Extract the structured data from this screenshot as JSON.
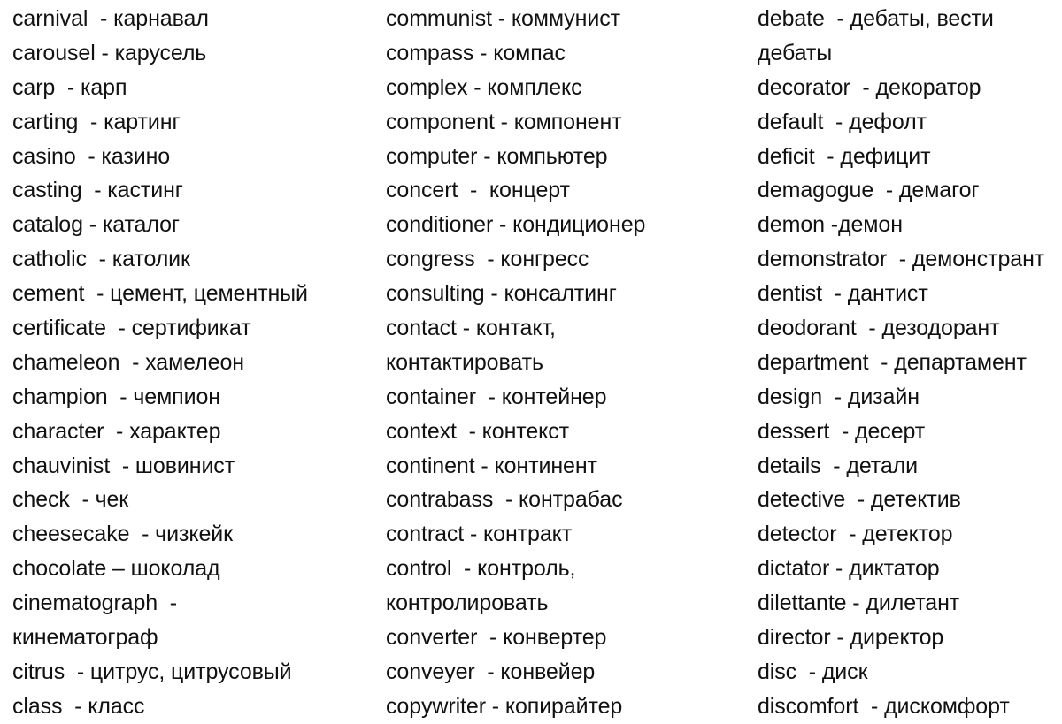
{
  "document": {
    "type": "bilingual-glossary",
    "source_language": "English",
    "target_language": "Russian",
    "separator_default": " - ",
    "background_color": "#ffffff",
    "text_color": "#111111",
    "columns": [
      {
        "id": "column-1",
        "letter_range": "ca–cl",
        "lines": [
          "carnival  - карнавал",
          "carousel - карусель",
          "carp  - карп",
          "carting  - картинг",
          "casino  - казино",
          "casting  - кастинг",
          "catalog - каталог",
          "catholic  - католик",
          "cement  - цемент, цементный",
          "certificate  - сертификат",
          "chameleon  - хамелеон",
          "champion  - чемпион",
          "character  - характер",
          "chauvinist  - шовинист",
          "check  - чек",
          "cheesecake  - чизкейк",
          "chocolate – шоколад",
          "cinematograph  -",
          "кинематограф",
          "citrus  - цитрус, цитрусовый",
          "class  - класс"
        ]
      },
      {
        "id": "column-2",
        "letter_range": "co",
        "lines": [
          "communist - коммунист",
          "compass - компас",
          "complex - комплекс",
          "component - компонент",
          "computer - компьютер",
          "concert  -  концерт",
          "conditioner - кондиционер",
          "congress  - конгресс",
          "consulting - консалтинг",
          "contact - контакт,",
          "контактировать",
          "container  - контейнер",
          "context  - контекст",
          "continent - континент",
          "contrabass  - контрабас",
          "contract - контракт",
          "control  - контроль,",
          "контролировать",
          "converter  - конвертер",
          "conveyer  - конвейер",
          "copywriter - копирайтер"
        ]
      },
      {
        "id": "column-3",
        "letter_range": "de–di",
        "lines": [
          "debate  - дебаты, вести",
          "дебаты",
          "decorator  - декоратор",
          "default  - дефолт",
          "deficit  - дефицит",
          "demagogue  - демагог",
          "demon -демон",
          "demonstrator  - демонстрант",
          "dentist  - дантист",
          "deodorant  - дезодорант",
          "department  - департамент",
          "design  - дизайн",
          "dessert  - десерт",
          "details  - детали",
          "detective  - детектив",
          "detector  - детектор",
          "dictator - диктатор",
          "dilettante - дилетант",
          "director - директор",
          "disc  - диск",
          "discomfort  - дискомфорт"
        ]
      }
    ]
  }
}
